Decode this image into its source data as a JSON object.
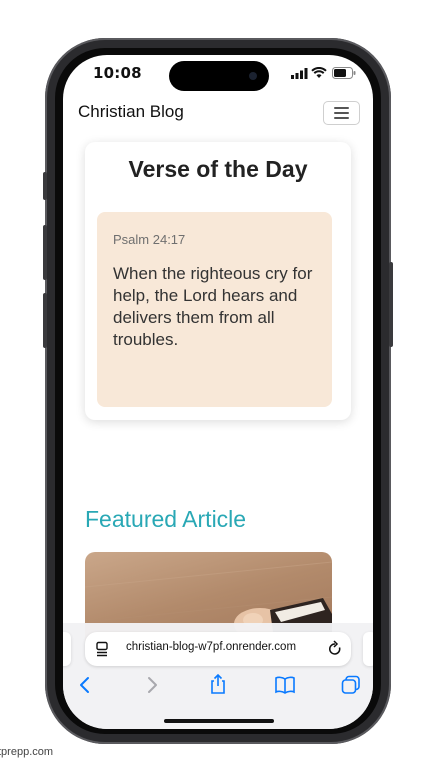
{
  "status_bar": {
    "time": "10:08"
  },
  "navbar": {
    "brand": "Christian Blog"
  },
  "verse_of_day": {
    "title": "Verse of the Day",
    "reference": "Psalm 24:17",
    "text": "When the righteous cry for help, the Lord hears and delivers them from all troubles."
  },
  "featured": {
    "heading": "Featured Article"
  },
  "browser": {
    "url": "christian-blog-w7pf.onrender.com"
  },
  "caption": {
    "text": "tprepp.com"
  },
  "colors": {
    "accent": "#29a8b5",
    "verse_bg": "#f8e8d8",
    "ios_blue": "#0a7aff"
  }
}
